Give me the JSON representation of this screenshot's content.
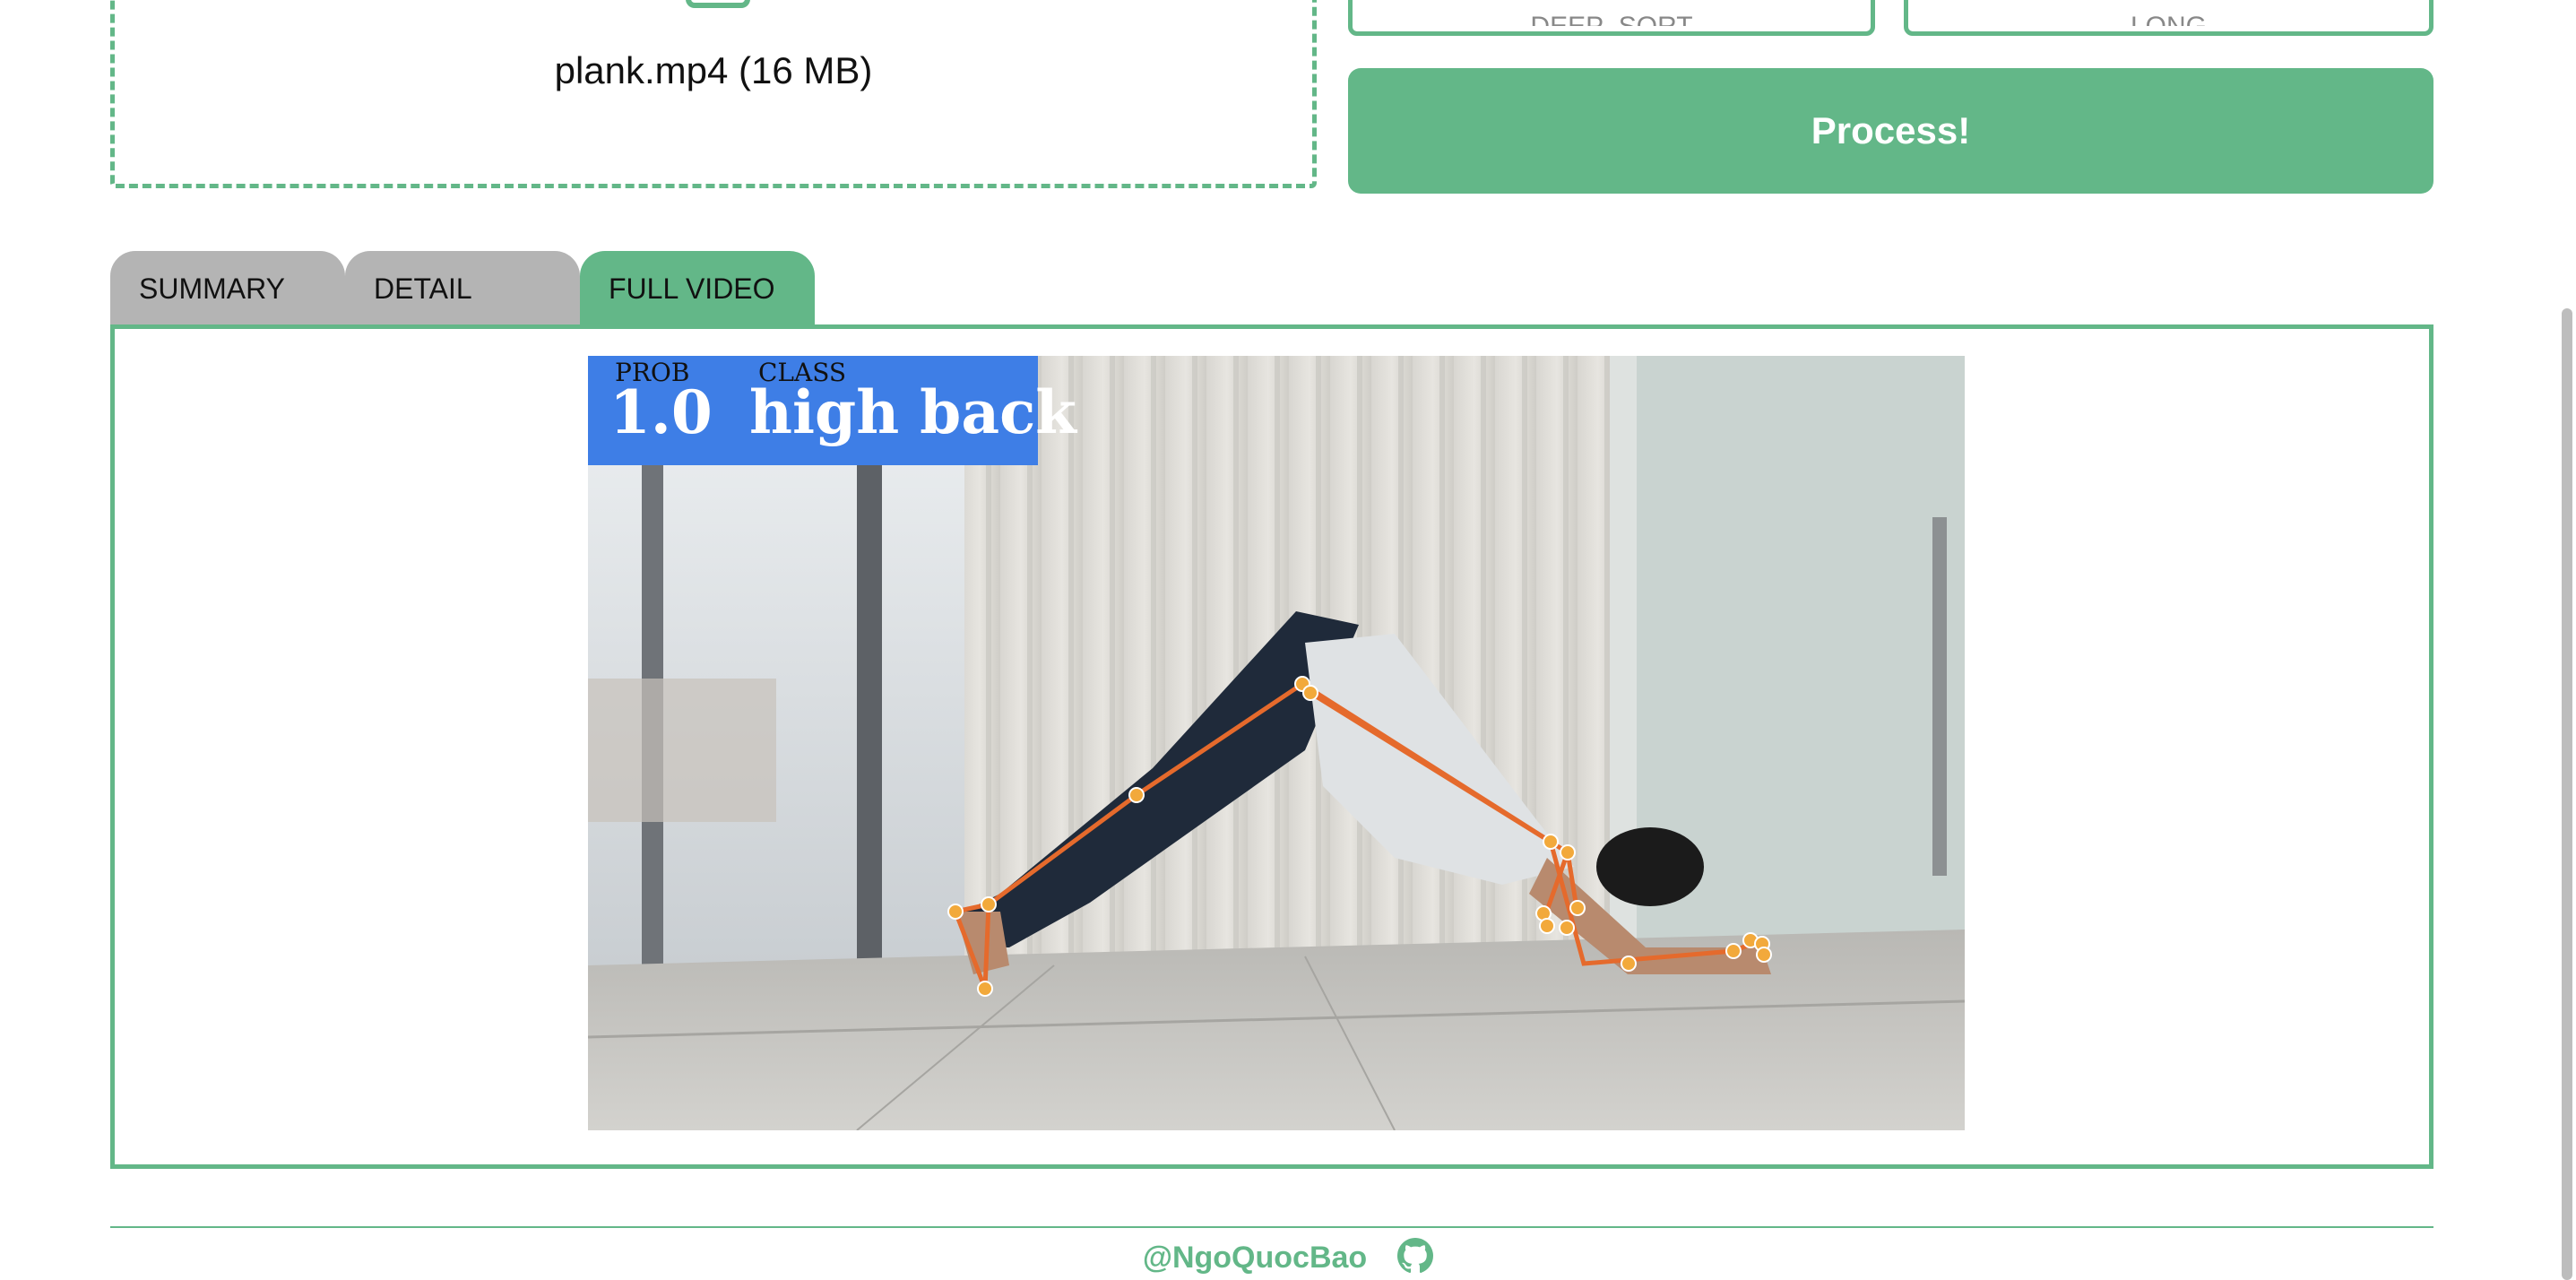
{
  "upload": {
    "file_name": "plank.mp4 (16 MB)"
  },
  "selects": {
    "first_value": "DEEP_SORT",
    "second_value": "LONG"
  },
  "process_button": {
    "label": "Process!"
  },
  "tabs": [
    {
      "label": "SUMMARY",
      "active": false
    },
    {
      "label": "DETAIL",
      "active": false
    },
    {
      "label": "FULL VIDEO",
      "active": true
    }
  ],
  "video": {
    "overlay": {
      "prob_header": "PROB",
      "class_header": "CLASS",
      "prob_value": "1.0",
      "class_value": "high back"
    },
    "overlay_color": "#3e7ee6",
    "skeleton_color": "#e56a2c",
    "keypoint_color": "#f2a93b"
  },
  "footer": {
    "handle": "@NgoQuocBao",
    "icon": "github-icon"
  },
  "colors": {
    "accent": "#63b788",
    "tab_inactive": "#b4b4b4"
  }
}
